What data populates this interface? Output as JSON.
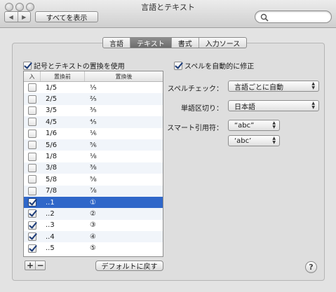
{
  "window": {
    "title": "言語とテキスト"
  },
  "toolbar": {
    "back_icon": "◀",
    "forward_icon": "▶",
    "show_all_label": "すべてを表示",
    "search": {
      "value": "",
      "placeholder": ""
    }
  },
  "tabs": [
    {
      "label": "言語",
      "active": false
    },
    {
      "label": "テキスト",
      "active": true
    },
    {
      "label": "書式",
      "active": false
    },
    {
      "label": "入力ソース",
      "active": false
    }
  ],
  "substitution": {
    "checkbox_label": "記号とテキストの置換を使用",
    "checked": true,
    "headers": {
      "on": "入",
      "replace": "置換前",
      "with": "置換後"
    },
    "rows": [
      {
        "replace": "1/5",
        "with": "⅕",
        "checked": false
      },
      {
        "replace": "2/5",
        "with": "⅖",
        "checked": false
      },
      {
        "replace": "3/5",
        "with": "⅗",
        "checked": false
      },
      {
        "replace": "4/5",
        "with": "⅘",
        "checked": false
      },
      {
        "replace": "1/6",
        "with": "⅙",
        "checked": false
      },
      {
        "replace": "5/6",
        "with": "⅚",
        "checked": false
      },
      {
        "replace": "1/8",
        "with": "⅛",
        "checked": false
      },
      {
        "replace": "3/8",
        "with": "⅜",
        "checked": false
      },
      {
        "replace": "5/8",
        "with": "⅝",
        "checked": false
      },
      {
        "replace": "7/8",
        "with": "⅞",
        "checked": false
      },
      {
        "replace": "..1",
        "with": "①",
        "checked": true,
        "selected": true
      },
      {
        "replace": "..2",
        "with": "②",
        "checked": true
      },
      {
        "replace": "..3",
        "with": "③",
        "checked": true
      },
      {
        "replace": "..4",
        "with": "④",
        "checked": true
      },
      {
        "replace": "..5",
        "with": "⑤",
        "checked": true
      }
    ],
    "add_label": "+",
    "remove_label": "−",
    "restore_label": "デフォルトに戻す"
  },
  "spelling": {
    "auto_correct_label": "スペルを自動的に修正",
    "auto_correct_checked": true,
    "spell_check_label": "スペルチェック：",
    "spell_check_value": "言語ごとに自動",
    "word_break_label": "単語区切り：",
    "word_break_value": "日本語",
    "smart_quotes_label": "スマート引用符：",
    "double_quote_value": "“abc”",
    "single_quote_value": "‘abc’"
  },
  "help_label": "?"
}
